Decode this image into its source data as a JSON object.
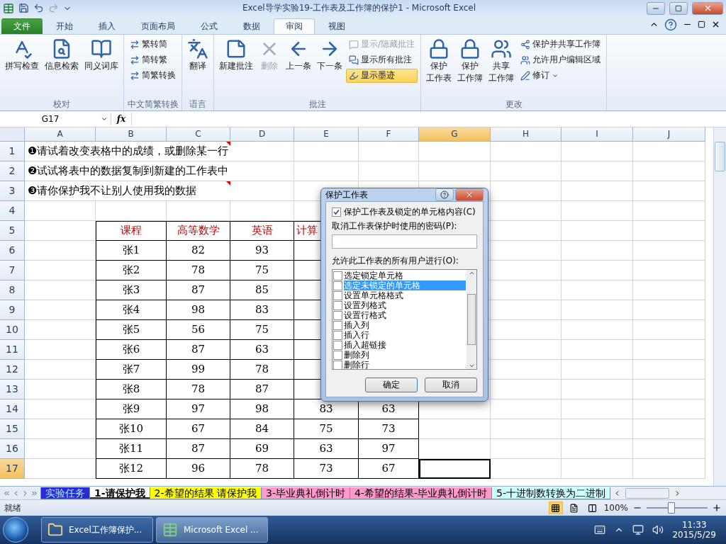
{
  "window": {
    "title": "Excel导学实验19-工作表及工作簿的保护1  -  Microsoft Excel"
  },
  "ribbon_tabs": [
    {
      "label": "文件",
      "kind": "file",
      "selected": false
    },
    {
      "label": "开始",
      "kind": "tab",
      "selected": false
    },
    {
      "label": "插入",
      "kind": "tab",
      "selected": false
    },
    {
      "label": "页面布局",
      "kind": "tab",
      "selected": false
    },
    {
      "label": "公式",
      "kind": "tab",
      "selected": false
    },
    {
      "label": "数据",
      "kind": "tab",
      "selected": false
    },
    {
      "label": "审阅",
      "kind": "tab",
      "selected": true
    },
    {
      "label": "视图",
      "kind": "tab",
      "selected": false
    }
  ],
  "ribbon_groups": [
    {
      "label": "校对",
      "items": [
        {
          "kind": "large",
          "lines": [
            "拼写检查"
          ],
          "disabled": false,
          "selected": false
        },
        {
          "kind": "large",
          "lines": [
            "信息检索"
          ],
          "disabled": false,
          "selected": false
        },
        {
          "kind": "large",
          "lines": [
            "同义词库"
          ],
          "disabled": false,
          "selected": false
        }
      ]
    },
    {
      "label": "中文简繁转换",
      "items": [
        {
          "kind": "small",
          "lines": [
            "繁转简"
          ],
          "disabled": false,
          "selected": false
        },
        {
          "kind": "small",
          "lines": [
            "简转繁"
          ],
          "disabled": false,
          "selected": false
        },
        {
          "kind": "small",
          "lines": [
            "简繁转换"
          ],
          "disabled": false,
          "selected": false
        }
      ]
    },
    {
      "label": "语言",
      "items": [
        {
          "kind": "large",
          "lines": [
            "翻译"
          ],
          "disabled": false,
          "selected": false
        }
      ]
    },
    {
      "label": "批注",
      "items": [
        {
          "kind": "large",
          "lines": [
            "新建批注"
          ],
          "disabled": false,
          "selected": false
        },
        {
          "kind": "large",
          "lines": [
            "删除"
          ],
          "disabled": true,
          "selected": false
        },
        {
          "kind": "large",
          "lines": [
            "上一条"
          ],
          "disabled": false,
          "selected": false
        },
        {
          "kind": "large",
          "lines": [
            "下一条"
          ],
          "disabled": false,
          "selected": false
        },
        {
          "kind": "small",
          "lines": [
            "显示/隐藏批注"
          ],
          "disabled": true,
          "selected": false
        },
        {
          "kind": "small",
          "lines": [
            "显示所有批注"
          ],
          "disabled": false,
          "selected": false
        },
        {
          "kind": "small",
          "lines": [
            "显示墨迹"
          ],
          "disabled": false,
          "selected": true
        }
      ]
    },
    {
      "label": "更改",
      "items": [
        {
          "kind": "large",
          "lines": [
            "保护",
            "工作表"
          ],
          "disabled": false,
          "selected": false
        },
        {
          "kind": "large",
          "lines": [
            "保护",
            "工作簿"
          ],
          "disabled": false,
          "selected": false
        },
        {
          "kind": "large",
          "lines": [
            "共享",
            "工作簿"
          ],
          "disabled": false,
          "selected": false
        },
        {
          "kind": "small",
          "lines": [
            "保护并共享工作簿"
          ],
          "disabled": false,
          "selected": false
        },
        {
          "kind": "small",
          "lines": [
            "允许用户编辑区域"
          ],
          "disabled": false,
          "selected": false
        },
        {
          "kind": "dropdown",
          "lines": [
            "修订"
          ],
          "disabled": false,
          "selected": false
        }
      ]
    }
  ],
  "formula_bar": {
    "name_box": "G17",
    "function_label": "fx"
  },
  "columns": [
    {
      "label": "A",
      "selected": false
    },
    {
      "label": "B",
      "selected": false
    },
    {
      "label": "C",
      "selected": false
    },
    {
      "label": "D",
      "selected": false
    },
    {
      "label": "E",
      "selected": false
    },
    {
      "label": "F",
      "selected": false
    },
    {
      "label": "G",
      "selected": true
    },
    {
      "label": "H",
      "selected": false
    },
    {
      "label": "I",
      "selected": false
    },
    {
      "label": "J",
      "selected": false
    }
  ],
  "rows": [
    {
      "label": "1",
      "selected": false,
      "note": {
        "text": "❶请试着改变表格中的成绩，或删除某一行",
        "comment": true
      }
    },
    {
      "label": "2",
      "selected": false,
      "note": {
        "text": "❷试试将表中的数据复制到新建的工作表中"
      }
    },
    {
      "label": "3",
      "selected": false,
      "note": {
        "text": "❸请你保护我不让别人使用我的数据",
        "comment": true
      }
    },
    {
      "label": "4",
      "selected": false
    },
    {
      "label": "5",
      "selected": false,
      "header": true,
      "cells": [
        "课程",
        "高等数学",
        "英语",
        "计算"
      ]
    },
    {
      "label": "6",
      "selected": false,
      "cells": [
        "张1",
        "82",
        "93"
      ]
    },
    {
      "label": "7",
      "selected": false,
      "cells": [
        "张2",
        "78",
        "75"
      ]
    },
    {
      "label": "8",
      "selected": false,
      "cells": [
        "张3",
        "87",
        "85"
      ]
    },
    {
      "label": "9",
      "selected": false,
      "cells": [
        "张4",
        "98",
        "83"
      ]
    },
    {
      "label": "10",
      "selected": false,
      "cells": [
        "张5",
        "56",
        "75"
      ]
    },
    {
      "label": "11",
      "selected": false,
      "cells": [
        "张6",
        "87",
        "63"
      ]
    },
    {
      "label": "12",
      "selected": false,
      "cells": [
        "张7",
        "99",
        "78"
      ]
    },
    {
      "label": "13",
      "selected": false,
      "cells": [
        "张8",
        "78",
        "87"
      ]
    },
    {
      "label": "14",
      "selected": false,
      "cells": [
        "张9",
        "97",
        "98",
        "83",
        "63"
      ]
    },
    {
      "label": "15",
      "selected": false,
      "cells": [
        "张10",
        "67",
        "84",
        "75",
        "73"
      ]
    },
    {
      "label": "16",
      "selected": false,
      "cells": [
        "张11",
        "87",
        "69",
        "63",
        "97"
      ]
    },
    {
      "label": "17",
      "selected": true,
      "cells": [
        "张12",
        "96",
        "78",
        "73",
        "67"
      ]
    }
  ],
  "dialog": {
    "title": "保护工作表",
    "protect": {
      "label": "保护工作表及锁定的单元格内容(C)",
      "checked": true
    },
    "password_label": "取消工作表保护时使用的密码(P):",
    "permissions_label": "允许此工作表的所有用户进行(O):",
    "permissions": [
      {
        "label": "选定锁定单元格",
        "checked": false,
        "selected": false
      },
      {
        "label": "选定未锁定的单元格",
        "checked": false,
        "selected": true
      },
      {
        "label": "设置单元格格式",
        "checked": false,
        "selected": false
      },
      {
        "label": "设置列格式",
        "checked": false,
        "selected": false
      },
      {
        "label": "设置行格式",
        "checked": false,
        "selected": false
      },
      {
        "label": "插入列",
        "checked": false,
        "selected": false
      },
      {
        "label": "插入行",
        "checked": false,
        "selected": false
      },
      {
        "label": "插入超链接",
        "checked": false,
        "selected": false
      },
      {
        "label": "删除列",
        "checked": false,
        "selected": false
      },
      {
        "label": "删除行",
        "checked": false,
        "selected": false
      }
    ],
    "buttons": [
      "确定",
      "取消"
    ]
  },
  "sheet_tabs": [
    {
      "label": "实验任务",
      "color": "#2a2ad8",
      "selected": false
    },
    {
      "label": "1-请保护我",
      "color": "#ffffff",
      "selected": true
    },
    {
      "label": "2-希望的结果 请保护我",
      "color": "#ffff00",
      "selected": false
    },
    {
      "label": "3-毕业典礼倒计时",
      "color": "#ff99cc",
      "selected": false
    },
    {
      "label": "4-希望的结果-毕业典礼倒计时",
      "color": "#ff99cc",
      "selected": false
    },
    {
      "label": "5-十进制数转换为二进制",
      "color": "#ccffff",
      "selected": false
    }
  ],
  "status_bar": {
    "status": "就绪",
    "zoom": "100%",
    "zoom_level": {
      "level": 0.4
    },
    "views": [
      {
        "selected": true
      },
      {
        "selected": false
      },
      {
        "selected": false
      }
    ]
  },
  "taskbar": {
    "buttons": [
      {
        "label": "Excel工作簿保护...",
        "kind": "folder",
        "selected": false
      },
      {
        "label": "Microsoft Excel ...",
        "kind": "excel",
        "selected": true
      }
    ],
    "time": "11:33",
    "date": "2015/5/29"
  }
}
